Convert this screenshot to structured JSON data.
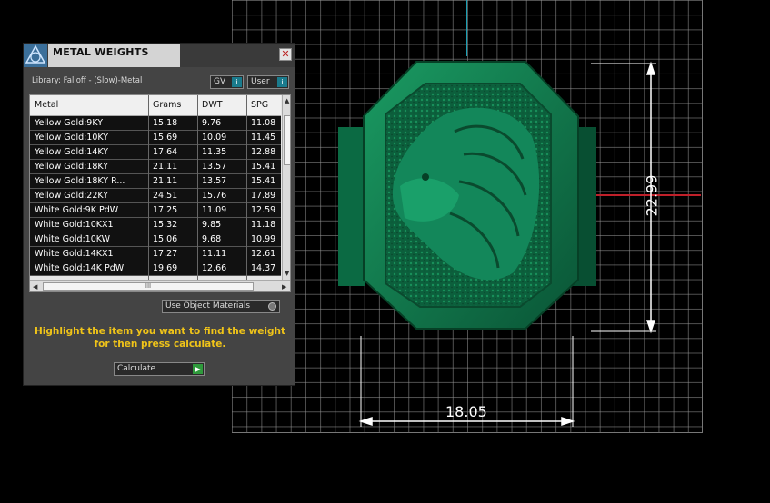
{
  "viewport": {
    "dim_height": "22.99",
    "dim_width": "18.05"
  },
  "panel": {
    "title": "METAL WEIGHTS",
    "close_glyph": "✕",
    "library_label": "Library: Falloff - (Slow)-Metal",
    "toggle_gv": "GV",
    "toggle_user": "User",
    "columns": [
      "Metal",
      "Grams",
      "DWT",
      "SPG"
    ],
    "rows": [
      {
        "metal": "Yellow Gold:9KY",
        "grams": "15.18",
        "dwt": "9.76",
        "spg": "11.08"
      },
      {
        "metal": "Yellow Gold:10KY",
        "grams": "15.69",
        "dwt": "10.09",
        "spg": "11.45"
      },
      {
        "metal": "Yellow Gold:14KY",
        "grams": "17.64",
        "dwt": "11.35",
        "spg": "12.88"
      },
      {
        "metal": "Yellow Gold:18KY",
        "grams": "21.11",
        "dwt": "13.57",
        "spg": "15.41"
      },
      {
        "metal": "Yellow Gold:18KY R...",
        "grams": "21.11",
        "dwt": "13.57",
        "spg": "15.41"
      },
      {
        "metal": "Yellow Gold:22KY",
        "grams": "24.51",
        "dwt": "15.76",
        "spg": "17.89"
      },
      {
        "metal": "White Gold:9K PdW",
        "grams": "17.25",
        "dwt": "11.09",
        "spg": "12.59"
      },
      {
        "metal": "White Gold:10KX1",
        "grams": "15.32",
        "dwt": "9.85",
        "spg": "11.18"
      },
      {
        "metal": "White Gold:10KW",
        "grams": "15.06",
        "dwt": "9.68",
        "spg": "10.99"
      },
      {
        "metal": "White Gold:14KX1",
        "grams": "17.27",
        "dwt": "11.11",
        "spg": "12.61"
      },
      {
        "metal": "White Gold:14K PdW",
        "grams": "19.69",
        "dwt": "12.66",
        "spg": "14.37"
      }
    ],
    "hscroll_glyph": "III",
    "use_object_materials": "Use Object Materials",
    "instructions": "Highlight the item you want to find the weight for then press calculate.",
    "calculate_label": "Calculate",
    "colors": {
      "accent": "#1a7b8d",
      "instructions": "#f0c419",
      "ring": "#0e7a4e"
    }
  }
}
